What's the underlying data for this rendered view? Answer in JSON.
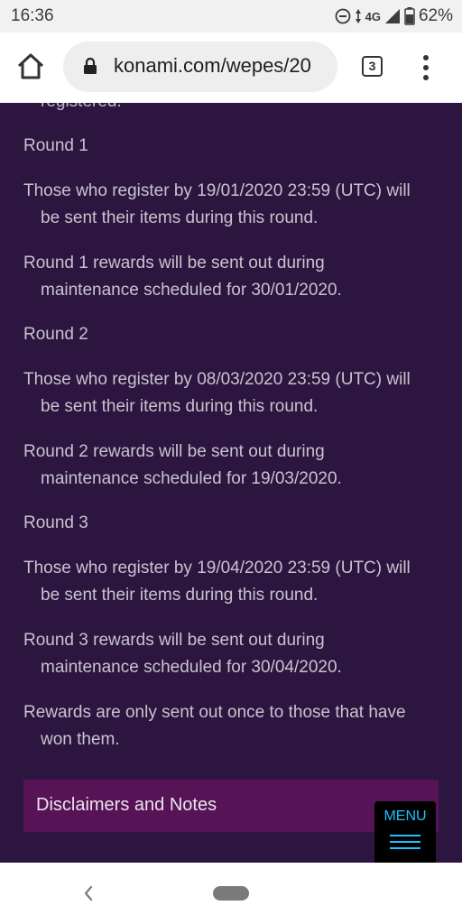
{
  "status_bar": {
    "time": "16:36",
    "network": "4G",
    "battery": "62%",
    "icons": [
      "do-not-disturb-icon",
      "data-arrows-icon",
      "signal-icon",
      "battery-icon"
    ]
  },
  "browser": {
    "url": "konami.com/wepes/20",
    "tab_count": "3",
    "icons": [
      "home-icon",
      "lock-icon",
      "more-vert-icon"
    ]
  },
  "content": {
    "clipped_text": "registered.",
    "paragraphs": [
      {
        "line1": "Round 1",
        "line2": ""
      },
      {
        "line1": "Those who register by 19/01/2020 23:59 (UTC) will",
        "line2": "be sent their items during this round."
      },
      {
        "line1": "Round 1 rewards will be sent out during",
        "line2": "maintenance scheduled for 30/01/2020."
      },
      {
        "line1": "Round 2",
        "line2": ""
      },
      {
        "line1": "Those who register by 08/03/2020 23:59 (UTC) will",
        "line2": "be sent their items during this round."
      },
      {
        "line1": "Round 2 rewards will be sent out during",
        "line2": "maintenance scheduled for 19/03/2020."
      },
      {
        "line1": "Round 3",
        "line2": ""
      },
      {
        "line1": "Those who register by 19/04/2020 23:59 (UTC) will",
        "line2": "be sent their items during this round."
      },
      {
        "line1": "Round 3 rewards will be sent out during",
        "line2": "maintenance scheduled for 30/04/2020."
      },
      {
        "line1": "Rewards are only sent out once to those that have",
        "line2": "won them."
      }
    ],
    "disclaimer_label": "Disclaimers and Notes",
    "menu_label": "MENU"
  },
  "colors": {
    "page_background": "#2c1640",
    "disclaimer_bar": "#561456",
    "menu_accent": "#1fc0ff"
  },
  "nav_bar": {
    "icons": [
      "back-icon",
      "home-pill-icon"
    ]
  }
}
